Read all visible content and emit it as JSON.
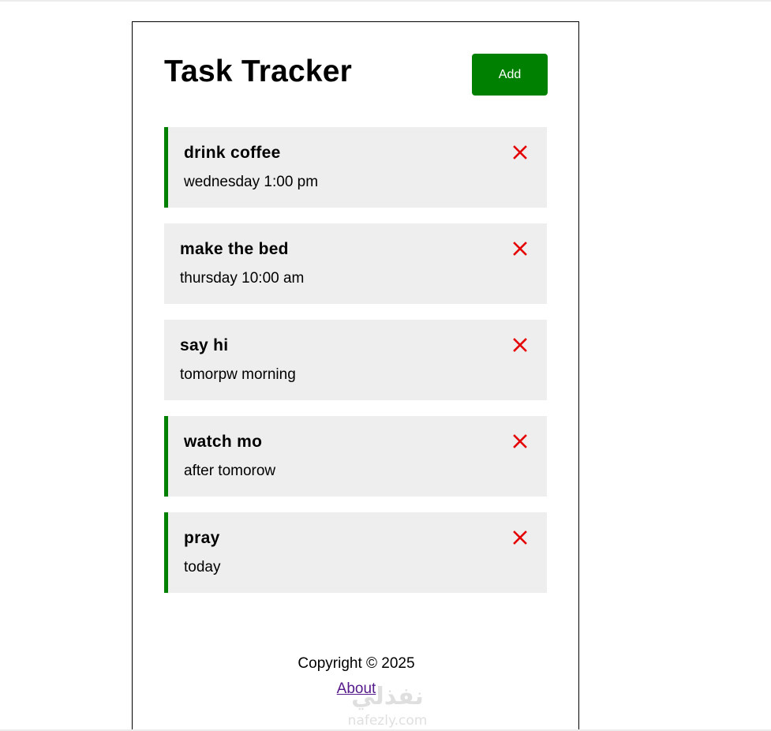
{
  "header": {
    "title": "Task Tracker",
    "add_label": "Add"
  },
  "tasks": [
    {
      "text": "drink coffee",
      "day": "wednesday 1:00 pm",
      "reminder": true
    },
    {
      "text": "make the bed",
      "day": "thursday 10:00 am",
      "reminder": false
    },
    {
      "text": "say hi",
      "day": "tomorpw morning",
      "reminder": false
    },
    {
      "text": "watch mo",
      "day": "after tomorow",
      "reminder": true
    },
    {
      "text": "pray",
      "day": "today",
      "reminder": true
    }
  ],
  "footer": {
    "copyright": "Copyright © 2025",
    "about_label": "About"
  },
  "watermark": {
    "text_ar": "نفذلي",
    "text_en": "nafezly.com"
  },
  "colors": {
    "accent": "#008000",
    "delete": "#e50000",
    "task_bg": "#eeeeee",
    "link": "#551a8b"
  },
  "icons": {
    "delete": "close-icon"
  }
}
